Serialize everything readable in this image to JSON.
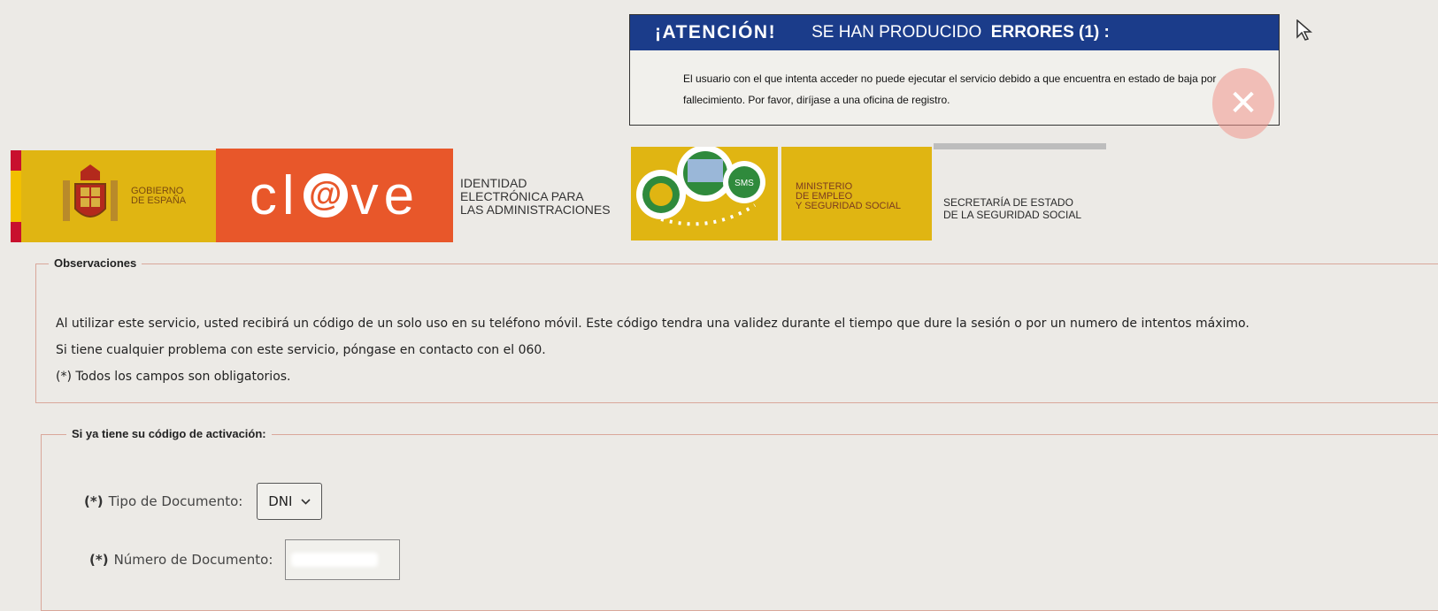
{
  "error": {
    "attention": "¡ATENCIÓN!",
    "heading_prefix": "SE HAN PRODUCIDO",
    "heading_strong": "ERRORES (1) :",
    "message": "El usuario con el que intenta acceder no puede ejecutar el servicio debido a que encuentra en estado de baja por fallecimiento. Por favor, diríjase a una oficina de registro.",
    "close_glyph": "✕"
  },
  "banner": {
    "gobierno_line1": "GOBIERNO",
    "gobierno_line2": "DE ESPAÑA",
    "clave_left": "cl",
    "clave_at": "@",
    "clave_right": "ve",
    "ident_line1": "IDENTIDAD",
    "ident_line2": "ELECTRÓNICA PARA",
    "ident_line3": "LAS ADMINISTRACIONES",
    "sms_label": "SMS",
    "ministerio_line1": "MINISTERIO",
    "ministerio_line2": "DE EMPLEO",
    "ministerio_line3": "Y SEGURIDAD SOCIAL",
    "secretaria_line1": "SECRETARÍA DE ESTADO",
    "secretaria_line2": "DE LA SEGURIDAD SOCIAL"
  },
  "observaciones": {
    "legend": "Observaciones",
    "line1": "Al utilizar este servicio, usted recibirá un código de un solo uso en su teléfono móvil. Este código tendra una validez durante el tiempo que dure la sesión o por un numero de intentos máximo.",
    "line2": "Si tiene cualquier problema con este servicio, póngase en contacto con el 060.",
    "line3": "(*) Todos los campos son obligatorios."
  },
  "activacion": {
    "legend": "Si ya tiene su código de activación:",
    "required_mark": "(*)",
    "tipo_label": "Tipo de Documento:",
    "tipo_value": "DNI",
    "numero_label": "Número de Documento:"
  },
  "colors": {
    "accent_blue": "#1b3c8a",
    "clave_orange": "#e8572a",
    "gob_yellow": "#e0b512"
  }
}
